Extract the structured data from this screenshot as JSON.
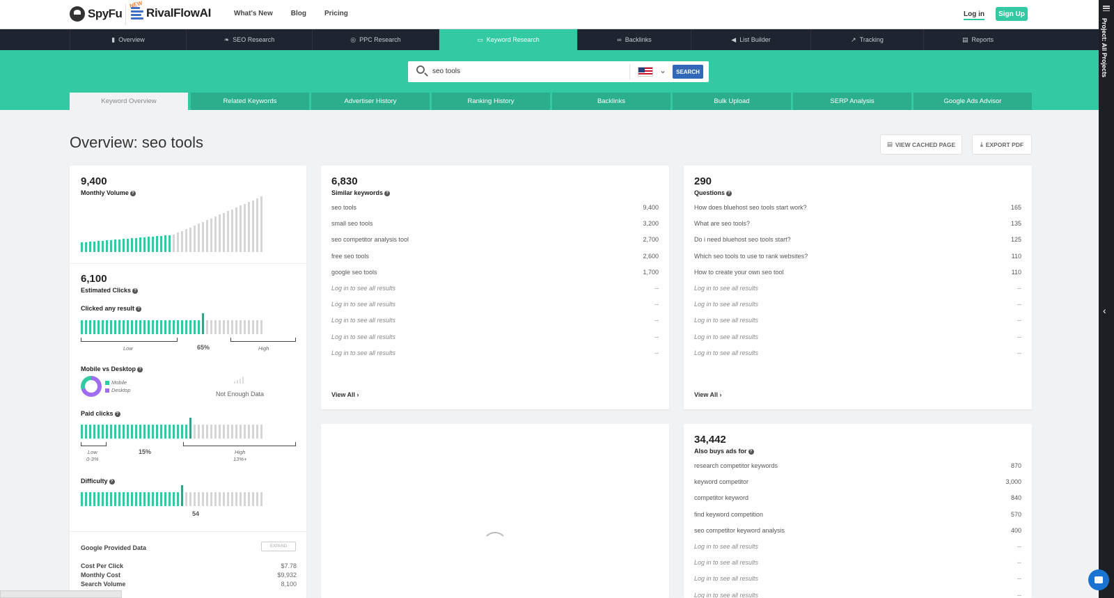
{
  "header": {
    "spyfu_logo": "SpyFu",
    "rivalflow_logo": "RivalFlowAI",
    "rivalflow_badge": "NEW",
    "nav": [
      "What's New",
      "Blog",
      "Pricing"
    ],
    "login": "Log in",
    "signup": "Sign Up"
  },
  "rightbar": {
    "label": "Project: All Projects"
  },
  "mainnav": {
    "tabs": [
      {
        "label": "Overview",
        "icon": "bar-chart-icon"
      },
      {
        "label": "SEO Research",
        "icon": "leaf-icon"
      },
      {
        "label": "PPC Research",
        "icon": "target-icon"
      },
      {
        "label": "Keyword Research",
        "icon": "keyboard-icon",
        "active": true
      },
      {
        "label": "Backlinks",
        "icon": "link-icon"
      },
      {
        "label": "List Builder",
        "icon": "megaphone-icon"
      },
      {
        "label": "Tracking",
        "icon": "trend-icon"
      },
      {
        "label": "Reports",
        "icon": "document-icon"
      }
    ]
  },
  "search": {
    "query": "seo tools",
    "button": "SEARCH",
    "country": "US"
  },
  "subtabs": [
    "Keyword Overview",
    "Related Keywords",
    "Advertiser History",
    "Ranking History",
    "Backlinks",
    "Bulk Upload",
    "SERP Analysis",
    "Google Ads Advisor"
  ],
  "page": {
    "title": "Overview: seo tools",
    "view_cached": "VIEW CACHED PAGE",
    "export_pdf": "EXPORT PDF"
  },
  "left_card": {
    "monthly_volume": {
      "value": "9,400",
      "label": "Monthly Volume"
    },
    "estimated_clicks": {
      "value": "6,100",
      "label": "Estimated Clicks"
    },
    "clicked_any": {
      "label": "Clicked any result",
      "low": "Low",
      "high": "High",
      "pct": "65%",
      "fraction": 0.65
    },
    "mobile_desktop": {
      "label": "Mobile vs Desktop",
      "mobile": "Mobile",
      "desktop": "Desktop",
      "not_enough": "Not Enough Data"
    },
    "paid_clicks": {
      "label": "Paid clicks",
      "low": "Low",
      "low_range": "0-3%",
      "high": "High",
      "high_range": "13%+",
      "pct": "15%",
      "fraction": 0.6
    },
    "difficulty": {
      "label": "Difficulty",
      "value": "54",
      "fraction": 0.54
    },
    "google_data": {
      "title": "Google Provided Data",
      "expand": "EXPAND",
      "rows": [
        {
          "k": "Cost Per Click",
          "v": "$7.78"
        },
        {
          "k": "Monthly Cost",
          "v": "$9,932"
        },
        {
          "k": "Search Volume",
          "v": "8,100"
        }
      ]
    }
  },
  "similar": {
    "value": "6,830",
    "label": "Similar keywords",
    "rows": [
      {
        "k": "seo tools",
        "v": "9,400"
      },
      {
        "k": "small seo tools",
        "v": "3,200"
      },
      {
        "k": "seo competitor analysis tool",
        "v": "2,700"
      },
      {
        "k": "free seo tools",
        "v": "2,600"
      },
      {
        "k": "google seo tools",
        "v": "1,700"
      },
      {
        "k": "Log in to see all results",
        "v": "--",
        "locked": true
      },
      {
        "k": "Log in to see all results",
        "v": "--",
        "locked": true
      },
      {
        "k": "Log in to see all results",
        "v": "--",
        "locked": true
      },
      {
        "k": "Log in to see all results",
        "v": "--",
        "locked": true
      },
      {
        "k": "Log in to see all results",
        "v": "--",
        "locked": true
      }
    ],
    "view_all": "View All"
  },
  "questions": {
    "value": "290",
    "label": "Questions",
    "rows": [
      {
        "k": "How does bluehost seo tools start work?",
        "v": "165"
      },
      {
        "k": "What are seo tools?",
        "v": "135"
      },
      {
        "k": "Do i need bluehost seo tools start?",
        "v": "125"
      },
      {
        "k": "Which seo tools to use to rank websites?",
        "v": "110"
      },
      {
        "k": "How to create your own seo tool",
        "v": "110"
      },
      {
        "k": "Log in to see all results",
        "v": "--",
        "locked": true
      },
      {
        "k": "Log in to see all results",
        "v": "--",
        "locked": true
      },
      {
        "k": "Log in to see all results",
        "v": "--",
        "locked": true
      },
      {
        "k": "Log in to see all results",
        "v": "--",
        "locked": true
      },
      {
        "k": "Log in to see all results",
        "v": "--",
        "locked": true
      }
    ],
    "view_all": "View All"
  },
  "also_buys": {
    "value": "34,442",
    "label": "Also buys ads for",
    "rows": [
      {
        "k": "research competitor keywords",
        "v": "870"
      },
      {
        "k": "keyword competitor",
        "v": "3,000"
      },
      {
        "k": "competitor keyword",
        "v": "840"
      },
      {
        "k": "find keyword competition",
        "v": "570"
      },
      {
        "k": "seo competitor keyword analysis",
        "v": "400"
      },
      {
        "k": "Log in to see all results",
        "v": "--",
        "locked": true
      },
      {
        "k": "Log in to see all results",
        "v": "--",
        "locked": true
      },
      {
        "k": "Log in to see all results",
        "v": "--",
        "locked": true
      },
      {
        "k": "Log in to see all results",
        "v": "--",
        "locked": true
      }
    ]
  },
  "colors": {
    "teal": "#33c9a3",
    "teal_dark": "#2aae8c",
    "nav_dark": "#1f2530",
    "blue": "#3169b8",
    "purple": "#a06cf0"
  }
}
